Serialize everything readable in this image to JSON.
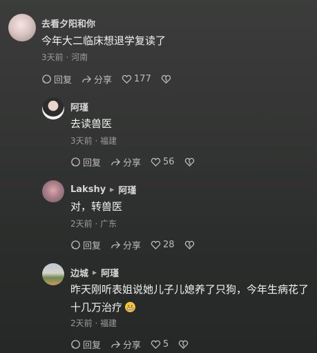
{
  "comments": [
    {
      "name": "去看夕阳和你",
      "text": "今年大二临床想退学复读了",
      "meta": "3天前 · 河南",
      "reply": "回复",
      "share": "分享",
      "likes": "177"
    },
    {
      "name": "阿瑾",
      "text": "去读兽医",
      "meta": "3天前 · 福建",
      "reply": "回复",
      "share": "分享",
      "likes": "56"
    },
    {
      "name": "Lakshy",
      "reply_to": "阿瑾",
      "text": "对，转兽医",
      "meta": "2天前 · 广东",
      "reply": "回复",
      "share": "分享",
      "likes": "28"
    },
    {
      "name": "边城",
      "reply_to": "阿瑾",
      "text": "昨天刚听表姐说她儿子儿媳养了只狗，今年生病花了十几万治疗",
      "meta": "2天前 · 福建",
      "reply": "回复",
      "share": "分享",
      "likes": "5"
    }
  ],
  "icons": {
    "reply": "comment-bubble-icon",
    "share": "share-arrow-icon",
    "like": "heart-icon",
    "dislike": "broken-heart-icon",
    "emoji": "grimacing-emoji-icon"
  }
}
